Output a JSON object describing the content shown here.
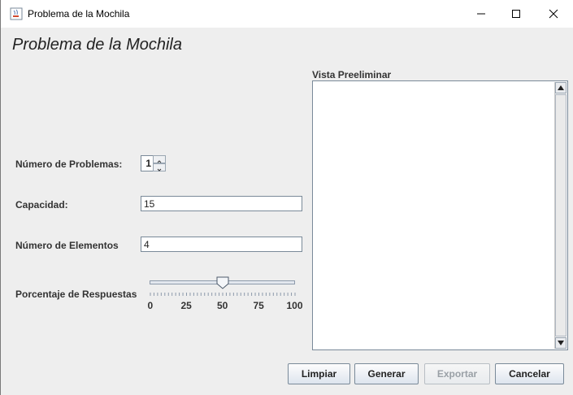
{
  "window": {
    "title": "Problema de la Mochila",
    "icon": "java-cup-icon"
  },
  "titlebar_controls": {
    "minimize": "minimize-icon",
    "maximize": "maximize-icon",
    "close": "close-icon"
  },
  "heading": "Problema de la Mochila",
  "form": {
    "num_problems_label": "Número de Problemas:",
    "num_problems_value": "1",
    "capacity_label": "Capacidad:",
    "capacity_value": "15",
    "num_elements_label": "Número de Elementos",
    "num_elements_value": "4",
    "percent_label": "Porcentaje de Respuestas",
    "slider": {
      "min": 0,
      "max": 100,
      "value": 50,
      "ticks": [
        "0",
        "25",
        "50",
        "75",
        "100"
      ]
    }
  },
  "preview": {
    "label": "Vista Preeliminar",
    "content": ""
  },
  "buttons": {
    "clear": "Limpiar",
    "generate": "Generar",
    "export": "Exportar",
    "cancel": "Cancelar"
  }
}
